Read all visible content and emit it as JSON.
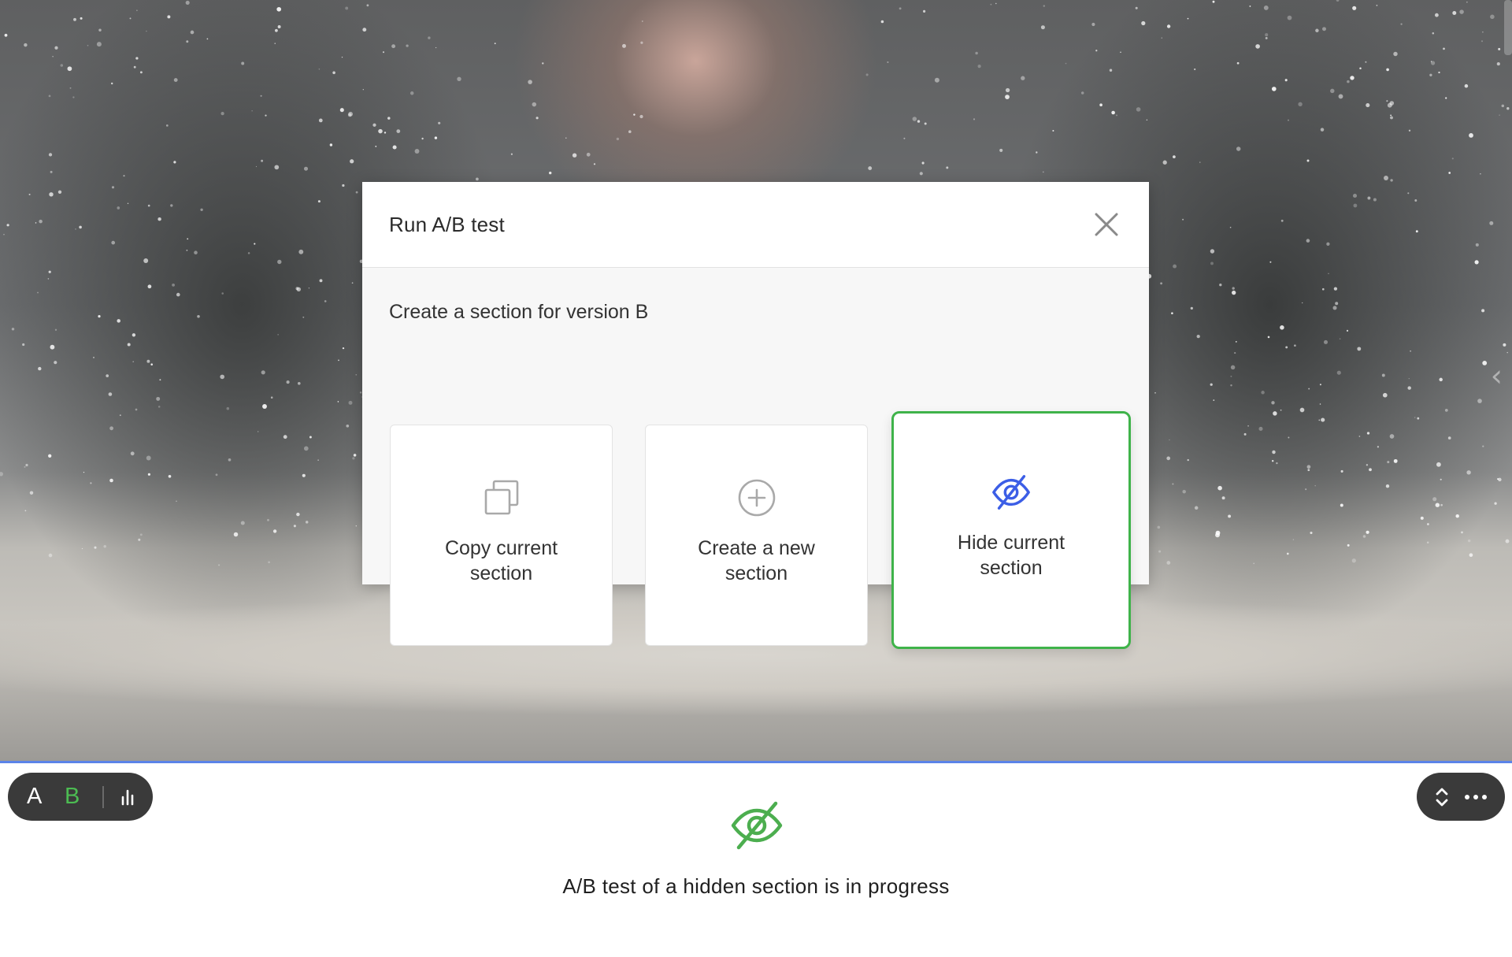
{
  "modal": {
    "title": "Run A/B test",
    "close_icon": "close-icon",
    "subtitle": "Create a section for version B",
    "options": [
      {
        "label": "Copy current section",
        "icon": "copy-icon",
        "selected": false
      },
      {
        "label": "Create a new section",
        "icon": "plus-circle-icon",
        "selected": false
      },
      {
        "label": "Hide current section",
        "icon": "eye-slash-icon",
        "selected": true
      }
    ]
  },
  "ab_toolbar": {
    "version_a": "A",
    "version_b": "B",
    "stats_icon": "bar-chart-icon"
  },
  "section_toolbar": {
    "move_icon": "chevron-up-down-icon",
    "more_icon": "more-horizontal-icon"
  },
  "hidden_section": {
    "icon": "eye-slash-icon",
    "message": "A/B test of a hidden section is in progress"
  },
  "colors": {
    "selected_accent": "#3fb34a",
    "version_b_green": "#4cbc52",
    "hidden_icon_blue": "#3c5ee6",
    "divider_blue": "#5b83e8",
    "toolbar_bg": "#3a3a3a"
  }
}
